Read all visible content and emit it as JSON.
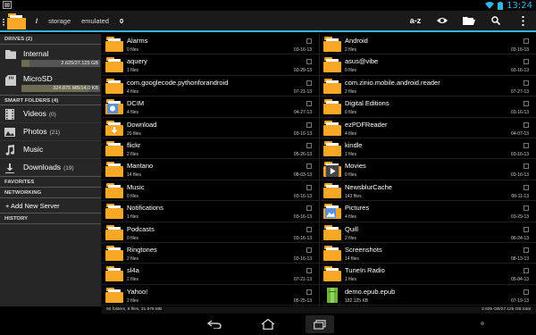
{
  "status": {
    "time": "13:24"
  },
  "breadcrumb": {
    "sep": "/",
    "items": [
      "storage",
      "emulated",
      "0"
    ]
  },
  "toolbar": {
    "sort_label": "a-z"
  },
  "sidebar": {
    "drives_header": "DRIVES (2)",
    "drives": [
      {
        "name": "Internal",
        "size": "2.625/27.125 GB",
        "fill": 0.097
      },
      {
        "name": "MicroSD",
        "size": "324.875 MB/14.0 KB",
        "fill": 0.85
      }
    ],
    "smart_header": "SMART FOLDERS (4)",
    "smart": [
      {
        "label": "Videos",
        "count": "(0)",
        "icon": "film-icon"
      },
      {
        "label": "Photos",
        "count": "(21)",
        "icon": "photo-icon"
      },
      {
        "label": "Music",
        "count": "",
        "icon": "music-icon"
      },
      {
        "label": "Downloads",
        "count": "(19)",
        "icon": "download-icon"
      }
    ],
    "favorites_header": "FAVORITES",
    "networking_header": "NETWORKING",
    "add_server": "+ Add New Server",
    "history_header": "HISTORY"
  },
  "files_left": [
    {
      "name": "Alarms",
      "count": "0 files",
      "date": "03-16-13"
    },
    {
      "name": "aquery",
      "count": "1 files",
      "date": "03-29-13"
    },
    {
      "name": "com.googlecode.pythonforandroid",
      "count": "4 files",
      "date": "07-21-13"
    },
    {
      "name": "DCIM",
      "count": "4 files",
      "date": "04-27-13",
      "badge": "photo"
    },
    {
      "name": "Download",
      "count": "20 files",
      "date": "03-16-13",
      "badge": "download"
    },
    {
      "name": "flickr",
      "count": "2 files",
      "date": "05-26-13"
    },
    {
      "name": "Mantano",
      "count": "14 files",
      "date": "08-03-13"
    },
    {
      "name": "Music",
      "count": "0 files",
      "date": "03-16-13"
    },
    {
      "name": "Notifications",
      "count": "1 files",
      "date": "03-16-13"
    },
    {
      "name": "Podcasts",
      "count": "0 files",
      "date": "03-16-13"
    },
    {
      "name": "Ringtones",
      "count": "2 files",
      "date": "03-16-13"
    },
    {
      "name": "sl4a",
      "count": "2 files",
      "date": "07-21-13"
    },
    {
      "name": "Yahoo!",
      "count": "2 files",
      "date": "05-25-13"
    }
  ],
  "files_right": [
    {
      "name": "Android",
      "count": "2 files",
      "date": "03-16-13"
    },
    {
      "name": "asus@vibe",
      "count": "0 files",
      "date": "03-16-13"
    },
    {
      "name": "com.zinio.mobile.android.reader",
      "count": "2 files",
      "date": "07-27-13"
    },
    {
      "name": "Digital Editions",
      "count": "0 files",
      "date": "03-16-13"
    },
    {
      "name": "ezPDFReader",
      "count": "4 files",
      "date": "04-07-13"
    },
    {
      "name": "kindle",
      "count": "1 files",
      "date": "03-16-13"
    },
    {
      "name": "Movies",
      "count": "0 files",
      "date": "03-16-13",
      "badge": "movie"
    },
    {
      "name": "NewsblurCache",
      "count": "143 files",
      "date": "08-11-13"
    },
    {
      "name": "Pictures",
      "count": "4 files",
      "date": "03-29-13",
      "badge": "pictures"
    },
    {
      "name": "Quill",
      "count": "2 files",
      "date": "06-24-13"
    },
    {
      "name": "Screenshots",
      "count": "14 files",
      "date": "08-13-13"
    },
    {
      "name": "TuneIn Radio",
      "count": "1 files",
      "date": "05-04-13"
    },
    {
      "name": "demo.epub.epub",
      "count": "182.125 KB",
      "date": "07-19-13",
      "badge": "epub"
    }
  ],
  "info": {
    "left": "50 folders, 8 files, 31.875 MB",
    "right": "2.625 GB/27.125 GB total"
  }
}
